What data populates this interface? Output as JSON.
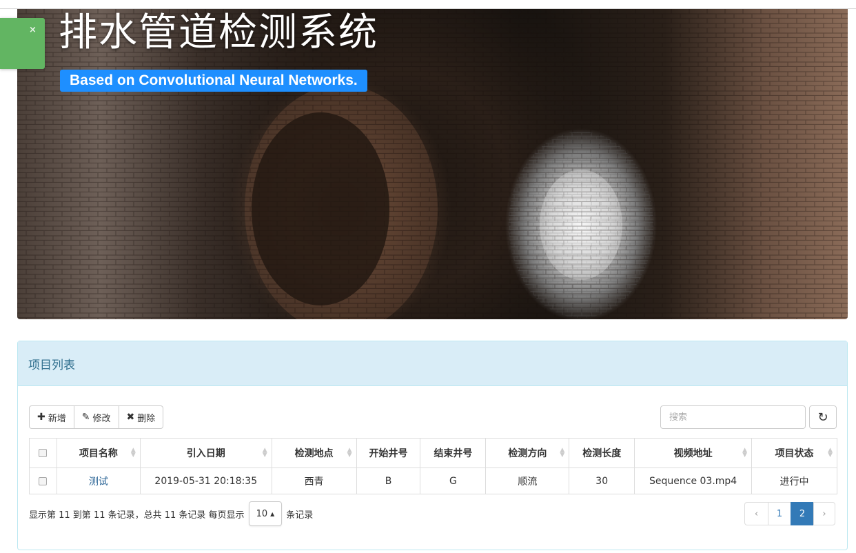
{
  "hero": {
    "title": "排水管道检测系统",
    "subtitle": "Based on Convolutional Neural Networks."
  },
  "toast": {
    "close": "×"
  },
  "panel": {
    "heading": "项目列表"
  },
  "toolbar": {
    "add_label": "新增",
    "edit_label": "修改",
    "delete_label": "删除"
  },
  "search": {
    "placeholder": "搜索"
  },
  "table": {
    "columns": [
      "项目名称",
      "引入日期",
      "检测地点",
      "开始井号",
      "结束井号",
      "检测方向",
      "检测长度",
      "视频地址",
      "项目状态"
    ],
    "rows": [
      [
        "测试",
        "2019-05-31 20:18:35",
        "西青",
        "B",
        "G",
        "顺流",
        "30",
        "Sequence 03.mp4",
        "进行中"
      ]
    ]
  },
  "footer": {
    "info": "显示第 11 到第 11 条记录，总共 11 条记录 每页显示",
    "page_size": "10",
    "suffix": "条记录"
  },
  "pagination": {
    "prev": "‹",
    "pages": [
      "1",
      "2"
    ],
    "next": "›",
    "active_page": "2"
  },
  "colors": {
    "accent": "#337ab7",
    "panel_heading_bg": "#d9edf7",
    "subtitle_bg": "#1e8fff",
    "toast_bg": "#62b562"
  }
}
